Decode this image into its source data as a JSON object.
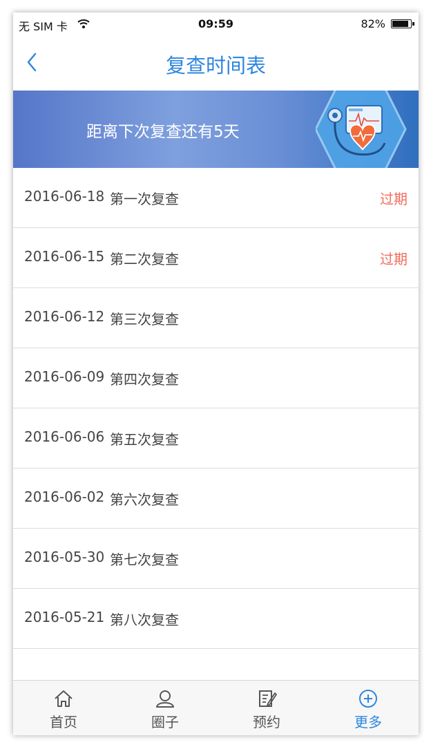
{
  "status_bar": {
    "carrier": "无 SIM 卡",
    "time": "09:59",
    "battery": "82%"
  },
  "nav": {
    "title": "复查时间表",
    "back_icon": "chevron-left-icon"
  },
  "banner": {
    "text": "距离下次复查还有5天"
  },
  "schedule": [
    {
      "date": "2016-06-18",
      "label": "第一次复查",
      "status": "过期"
    },
    {
      "date": "2016-06-15",
      "label": "第二次复查",
      "status": "过期"
    },
    {
      "date": "2016-06-12",
      "label": "第三次复查",
      "status": ""
    },
    {
      "date": "2016-06-09",
      "label": "第四次复查",
      "status": ""
    },
    {
      "date": "2016-06-06",
      "label": "第五次复查",
      "status": ""
    },
    {
      "date": "2016-06-02",
      "label": "第六次复查",
      "status": ""
    },
    {
      "date": "2016-05-30",
      "label": "第七次复查",
      "status": ""
    },
    {
      "date": "2016-05-21",
      "label": "第八次复查",
      "status": ""
    }
  ],
  "tabs": [
    {
      "label": "首页",
      "icon": "home-icon"
    },
    {
      "label": "圈子",
      "icon": "people-icon"
    },
    {
      "label": "预约",
      "icon": "edit-note-icon"
    },
    {
      "label": "更多",
      "icon": "plus-circle-icon"
    }
  ],
  "colors": {
    "accent": "#2e86de",
    "expired": "#f26b5b"
  }
}
